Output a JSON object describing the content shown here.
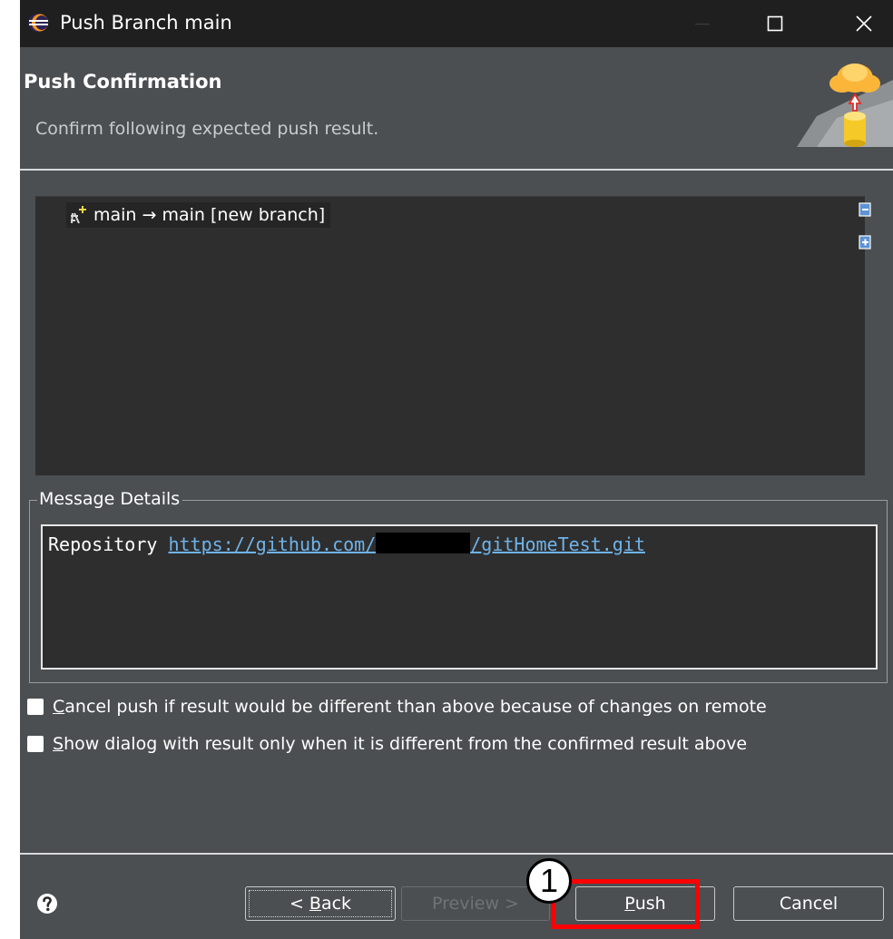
{
  "window": {
    "title": "Push Branch main",
    "icon": "eclipse-icon",
    "controls": [
      "minimize-icon",
      "maximize-icon",
      "close-icon"
    ]
  },
  "header": {
    "title": "Push Confirmation",
    "subtitle": "Confirm following expected push result.",
    "illustration": "cloud-push-icon"
  },
  "tree": {
    "items": [
      {
        "label": "main → main [new branch]",
        "icon": "new-branch-icon"
      }
    ],
    "side_buttons": [
      "collapse-all-icon",
      "expand-all-icon"
    ]
  },
  "message_details": {
    "legend": "Message Details",
    "prefix": "Repository ",
    "link_start": "https://github.com/",
    "link_end": "/gitHomeTest.git"
  },
  "options": {
    "cancel_push": {
      "first": "C",
      "rest": "ancel push if result would be different than above because of changes on remote",
      "checked": false
    },
    "show_dialog": {
      "first": "S",
      "rest": "how dialog with result only when it is different from the confirmed result above",
      "checked": false
    }
  },
  "buttons": {
    "back": {
      "prefix": "< ",
      "first": "B",
      "rest": "ack"
    },
    "preview": "Preview >",
    "push": {
      "first": "P",
      "rest": "ush"
    },
    "cancel": "Cancel"
  },
  "annotation": {
    "number": "1"
  },
  "colors": {
    "dialog_bg": "#4b4f52",
    "titlebar_bg": "#1f1f1f",
    "panel_bg": "#2e2e2e",
    "link": "#6fb3ea",
    "highlight": "#ff0000"
  }
}
